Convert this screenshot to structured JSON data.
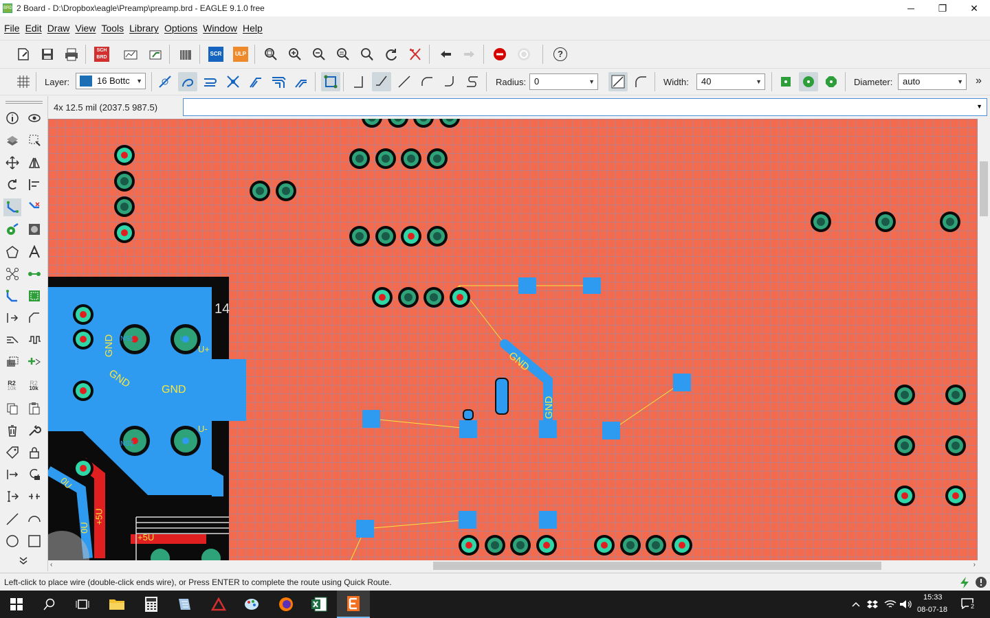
{
  "window": {
    "title": "2 Board - D:\\Dropbox\\eagle\\Preamp\\preamp.brd - EAGLE 9.1.0 free",
    "app_icon": "BRD",
    "minimize": "─",
    "maximize": "❐",
    "close": "✕"
  },
  "menu": [
    "File",
    "Edit",
    "Draw",
    "View",
    "Tools",
    "Library",
    "Options",
    "Window",
    "Help"
  ],
  "toolbar_main": {
    "sch_brd_label": "SCH BRD",
    "scr_label": "SCR",
    "ulp_label": "ULP",
    "help_label": "?"
  },
  "toolbar_route": {
    "layer_label": "Layer:",
    "layer_value": "16 Bottc",
    "radius_label": "Radius:",
    "radius_value": "0",
    "width_label": "Width:",
    "width_value": "40",
    "diameter_label": "Diameter:",
    "diameter_value": "auto",
    "more": "»"
  },
  "coordinates": "4x 12.5 mil (2037.5 987.5)",
  "command_input": {
    "value": ""
  },
  "left_tools": {
    "r2_label": "R2",
    "r2_value_1": "10k",
    "r2_value_2": "10k",
    "more": "»"
  },
  "board_labels": {
    "gnd_1": "GND",
    "gnd_2": "GND",
    "gnd_3": "GND",
    "gnd_4": "GND",
    "gnd_5": "GND",
    "u_plus": "U+",
    "u_minus": "U-",
    "ns1": "NS1",
    "ns2": "NS2",
    "u1": "U",
    "plus5v_1": "+5U",
    "plus5v_2": "+5U",
    "ou": "0U",
    "ou2": "0U",
    "num_14": "14"
  },
  "status": {
    "message": "Left-click to place wire (double-click ends wire), or Press ENTER to complete the route using Quick Route."
  },
  "taskbar": {
    "time": "15:33",
    "date": "08-07-18",
    "notification_count": "2"
  },
  "colors": {
    "canvas": "#f36b4e",
    "copper_bottom": "#2f9bf0",
    "pad": "#2fd6a8",
    "airwire": "#f7e640",
    "red_trace": "#e02020"
  }
}
